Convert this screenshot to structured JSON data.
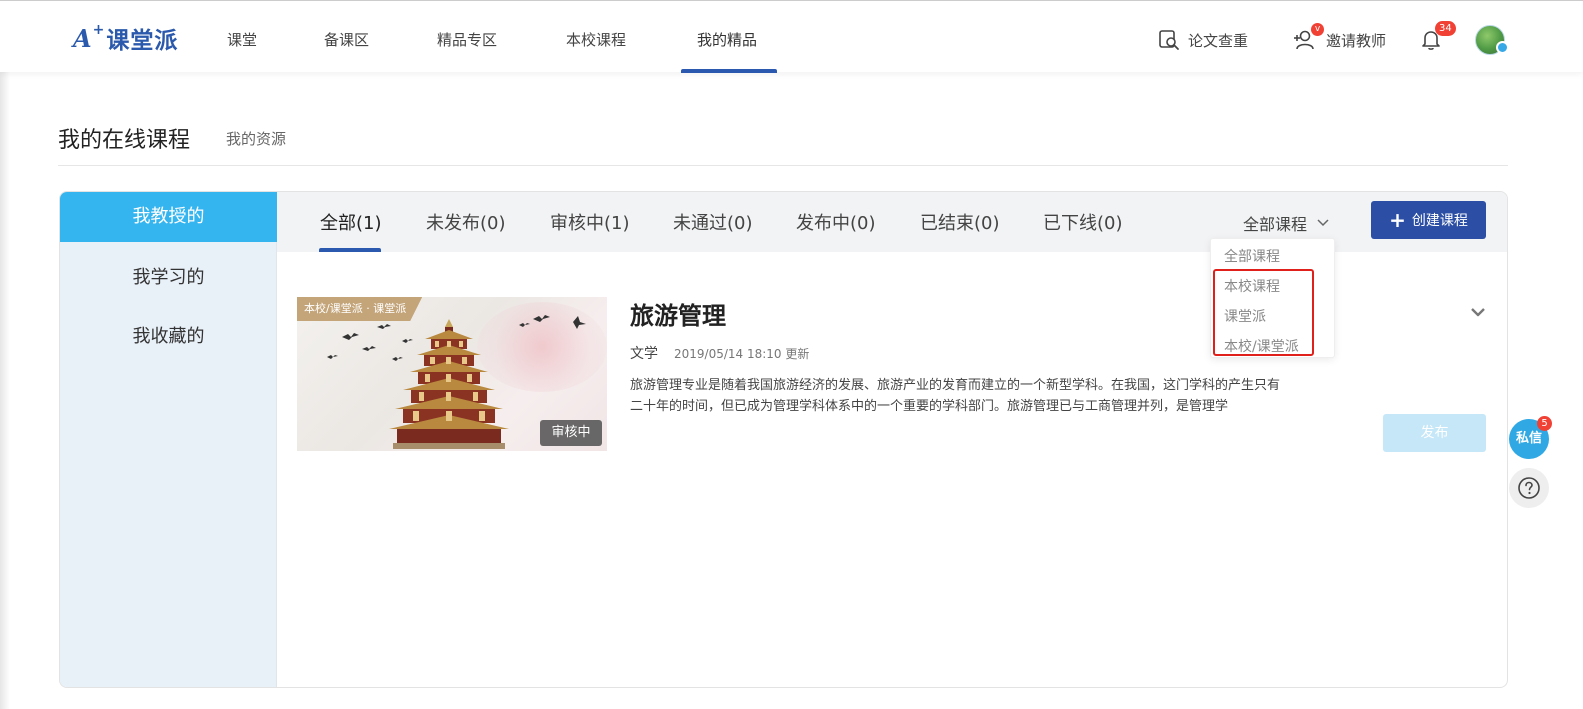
{
  "brand": {
    "logo_a": "A",
    "logo_plus": "+",
    "logo_text": "课堂派",
    "color": "#2b5aac"
  },
  "nav": {
    "items": [
      {
        "label": "课堂"
      },
      {
        "label": "备课区"
      },
      {
        "label": "精品专区"
      },
      {
        "label": "本校课程"
      },
      {
        "label": "我的精品"
      }
    ],
    "active": "我的精品",
    "right": {
      "plagiarism_check": "论文查重",
      "invite_teacher": "邀请教师",
      "invite_badge": "v",
      "notification_count": "34"
    }
  },
  "page": {
    "title": "我的在线课程",
    "subtitle": "我的资源"
  },
  "sidebar": {
    "items": [
      {
        "label": "我教授的"
      },
      {
        "label": "我学习的"
      },
      {
        "label": "我收藏的"
      }
    ],
    "active": "我教授的",
    "accent": "#35b5f0"
  },
  "tabs": {
    "items": [
      {
        "label": "全部(1)"
      },
      {
        "label": "未发布(0)"
      },
      {
        "label": "审核中(1)"
      },
      {
        "label": "未通过(0)"
      },
      {
        "label": "发布中(0)"
      },
      {
        "label": "已结束(0)"
      },
      {
        "label": "已下线(0)"
      }
    ],
    "active": "全部(1)",
    "filter": {
      "selected": "全部课程",
      "options": [
        "全部课程",
        "本校课程",
        "课堂派",
        "本校/课堂派"
      ]
    },
    "create_button": "创建课程"
  },
  "course": {
    "tag": "本校/课堂派 · 课堂派",
    "status": "审核中",
    "title": "旅游管理",
    "category": "文学",
    "updated": "2019/05/14 18:10 更新",
    "description": "旅游管理专业是随着我国旅游经济的发展、旅游产业的发育而建立的一个新型学科。在我国，这门学科的产生只有二十年的时间，但已成为管理学科体系中的一个重要的学科部门。旅游管理已与工商管理并列，是管理学",
    "publish_button": "发布"
  },
  "floating": {
    "message_label": "私信",
    "message_count": "5",
    "help_icon": "question-circle-icon"
  },
  "colors": {
    "primary": "#2c4fa5",
    "highlight_border": "#e0201b",
    "badge": "#f04134"
  }
}
